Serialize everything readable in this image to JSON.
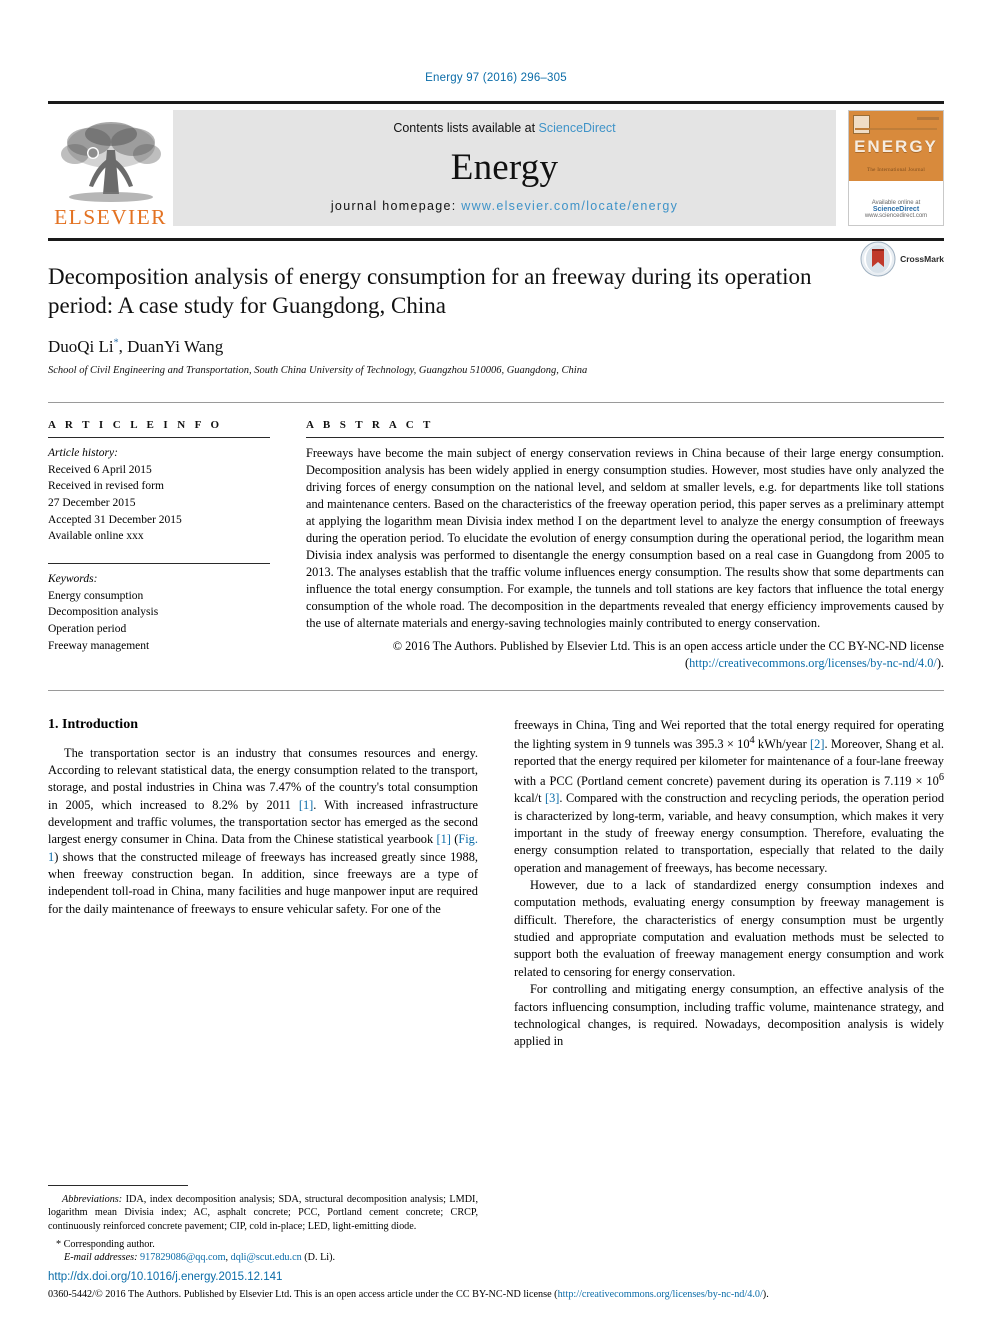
{
  "running_head": "Energy 97 (2016) 296–305",
  "masthead": {
    "publisher_name": "ELSEVIER",
    "contents_prefix": "Contents lists available at ",
    "contents_link": "ScienceDirect",
    "journal_title": "Energy",
    "homepage_prefix": "journal homepage: ",
    "homepage_url": "www.elsevier.com/locate/energy",
    "cover_title": "ENERGY",
    "cover_subtitle": "The International Journal",
    "cover_footer_prefix": "Available online at",
    "cover_footer_brand": "ScienceDirect",
    "cover_footer_url": "www.sciencedirect.com"
  },
  "article": {
    "title": "Decomposition analysis of energy consumption for an freeway during its operation period: A case study for Guangdong, China",
    "authors": "DuoQi Li",
    "authors_rest": ", DuanYi Wang",
    "author_marker": "*",
    "affiliation": "School of Civil Engineering and Transportation, South China University of Technology, Guangzhou 510006, Guangdong, China",
    "crossmark_label": "CrossMark"
  },
  "info": {
    "heading": "A R T I C L E   I N F O",
    "history_label": "Article history:",
    "history": [
      "Received 6 April 2015",
      "Received in revised form",
      "27 December 2015",
      "Accepted 31 December 2015",
      "Available online xxx"
    ],
    "keywords_label": "Keywords:",
    "keywords": [
      "Energy consumption",
      "Decomposition analysis",
      "Operation period",
      "Freeway management"
    ]
  },
  "abstract": {
    "heading": "A B S T R A C T",
    "text": "Freeways have become the main subject of energy conservation reviews in China because of their large energy consumption. Decomposition analysis has been widely applied in energy consumption studies. However, most studies have only analyzed the driving forces of energy consumption on the national level, and seldom at smaller levels, e.g. for departments like toll stations and maintenance centers. Based on the characteristics of the freeway operation period, this paper serves as a preliminary attempt at applying the logarithm mean Divisia index method I on the department level to analyze the energy consumption of freeways during the operation period. To elucidate the evolution of energy consumption during the operational period, the logarithm mean Divisia index analysis was performed to disentangle the energy consumption based on a real case in Guangdong from 2005 to 2013. The analyses establish that the traffic volume influences energy consumption. The results show that some departments can influence the total energy consumption. For example, the tunnels and toll stations are key factors that influence the total energy consumption of the whole road. The decomposition in the departments revealed that energy efficiency improvements caused by the use of alternate materials and energy-saving technologies mainly contributed to energy conservation.",
    "copyright_text": "© 2016 The Authors. Published by Elsevier Ltd. This is an open access article under the CC BY-NC-ND license (",
    "copyright_link": "http://creativecommons.org/licenses/by-nc-nd/4.0/",
    "copyright_tail": ")."
  },
  "body": {
    "section_heading": "1. Introduction",
    "left_para_1_a": "The transportation sector is an industry that consumes resources and energy. According to relevant statistical data, the energy consumption related to the transport, storage, and postal industries in China was 7.47% of the country's total consumption in 2005, which increased to 8.2% by 2011 ",
    "left_ref_1": "[1]",
    "left_para_1_b": ". With increased infrastructure development and traffic volumes, the transportation sector has emerged as the second largest energy consumer in China. Data from the Chinese statistical yearbook ",
    "left_ref_2": "[1]",
    "left_para_1_c": " (",
    "left_figref": "Fig. 1",
    "left_para_1_d": ") shows that the constructed mileage of freeways has increased greatly since 1988, when freeway construction began. In addition, since freeways are a type of independent toll-road in China, many facilities and huge manpower input are required for the daily maintenance of freeways to ensure vehicular safety. For one of the",
    "right_para_1_a": "freeways in China, Ting and Wei reported that the total energy required for operating the lighting system in 9 tunnels was 395.3 × 10",
    "right_sup_1": "4",
    "right_para_1_b": " kWh/year ",
    "right_ref_1": "[2]",
    "right_para_1_c": ". Moreover, Shang et al. reported that the energy required per kilometer for maintenance of a four-lane freeway with a PCC (Portland cement concrete) pavement during its operation is 7.119 × 10",
    "right_sup_2": "6",
    "right_para_1_d": " kcal/t ",
    "right_ref_2": "[3]",
    "right_para_1_e": ". Compared with the construction and recycling periods, the operation period is characterized by long-term, variable, and heavy consumption, which makes it very important in the study of freeway energy consumption. Therefore, evaluating the energy consumption related to transportation, especially that related to the daily operation and management of freeways, has become necessary.",
    "right_para_2": "However, due to a lack of standardized energy consumption indexes and computation methods, evaluating energy consumption by freeway management is difficult. Therefore, the characteristics of energy consumption must be urgently studied and appropriate computation and evaluation methods must be selected to support both the evaluation of freeway management energy consumption and work related to censoring for energy conservation.",
    "right_para_3": "For controlling and mitigating energy consumption, an effective analysis of the factors influencing consumption, including traffic volume, maintenance strategy, and technological changes, is required. Nowadays, decomposition analysis is widely applied in"
  },
  "footnotes": {
    "abbrev_label": "Abbreviations:",
    "abbrev_text": " IDA, index decomposition analysis; SDA, structural decomposition analysis; LMDI, logarithm mean Divisia index; AC, asphalt concrete; PCC, Portland cement concrete; CRCP, continuously reinforced concrete pavement; CIP, cold in-place; LED, light-emitting diode.",
    "corresponding_marker": "*",
    "corresponding_text": " Corresponding author.",
    "email_label": "E-mail addresses:",
    "email_1": "917829086@qq.com",
    "email_sep": ", ",
    "email_2": "dqli@scut.edu.cn",
    "email_tail": " (D. Li)."
  },
  "footer": {
    "doi": "http://dx.doi.org/10.1016/j.energy.2015.12.141",
    "issn_prefix": "0360-5442/© 2016 The Authors. Published by Elsevier Ltd. This is an open access article under the CC BY-NC-ND license (",
    "issn_link": "http://creativecommons.org/licenses/by-nc-nd/4.0/",
    "issn_tail": ")."
  },
  "colors": {
    "link": "#0b6ca8",
    "elsevier_orange": "#E37222",
    "masthead_bg": "#e4e4e4",
    "cover_orange": "#d88a3c"
  }
}
